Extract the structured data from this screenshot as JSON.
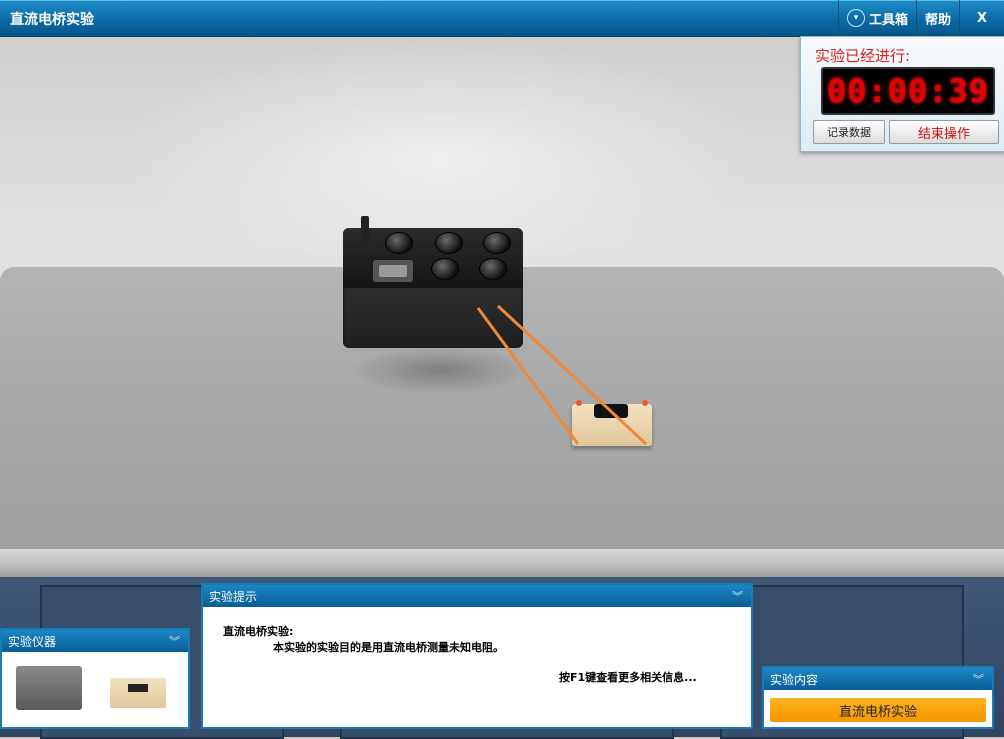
{
  "window": {
    "title": "直流电桥实验",
    "toolbox_label": "工具箱",
    "help_label": "帮助",
    "close_label": "X"
  },
  "timer": {
    "label": "实验已经进行:",
    "value": "00:00:39",
    "record_button": "记录数据",
    "end_button": "结束操作"
  },
  "tips_panel": {
    "title": "实验提示",
    "heading": "直流电桥实验:",
    "description": "本实验的实验目的是用直流电桥测量未知电阻。",
    "hint": "按F1键查看更多相关信息..."
  },
  "instruments_panel": {
    "title": "实验仪器"
  },
  "content_panel": {
    "title": "实验内容",
    "item": "直流电桥实验"
  },
  "colors": {
    "titlebar": "#0b6aa6",
    "timer_text": "#e60000",
    "accent_orange": "#f59600",
    "wire": "#f0883a"
  },
  "icons": {
    "toolbox": "chevron-down-icon",
    "collapse": "double-chevron-icon"
  }
}
